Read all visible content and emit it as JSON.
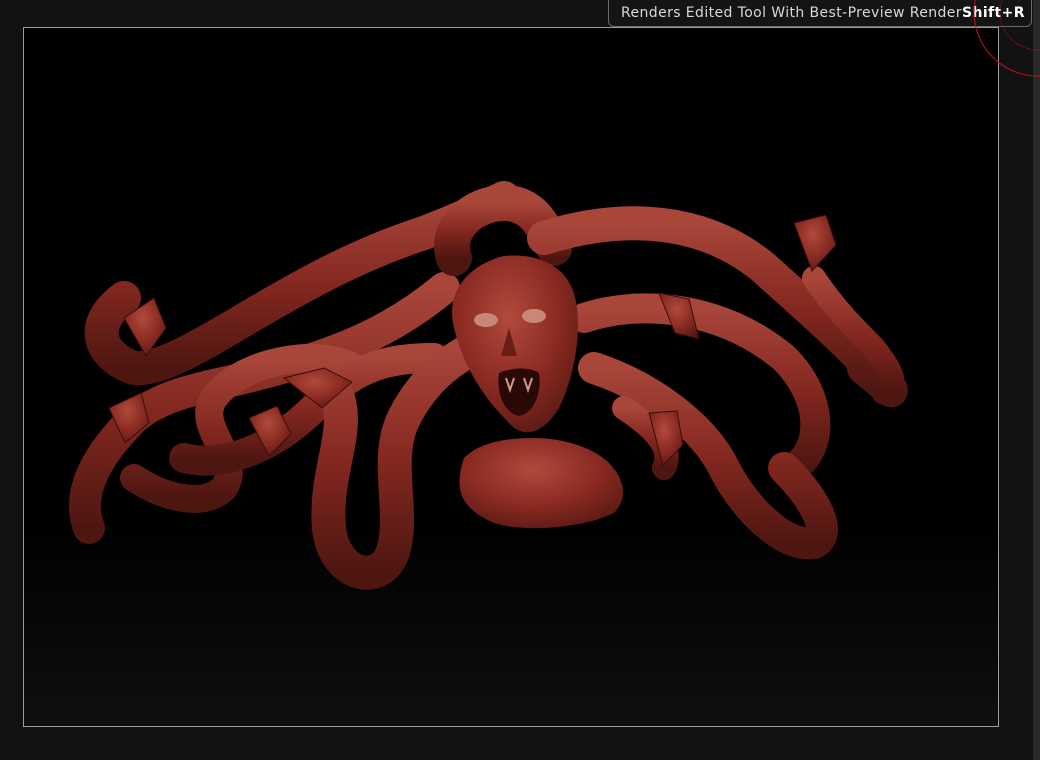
{
  "tooltip": {
    "description": "Renders Edited Tool With Best-Preview Render",
    "shortcut": "Shift+R"
  },
  "viewport": {
    "subject": "medusa-sculpt",
    "material_color": "#8a2a22",
    "background_color": "#000000",
    "frame_color": "#9a9a9a"
  },
  "gizmo": {
    "color": "#c0141a"
  }
}
